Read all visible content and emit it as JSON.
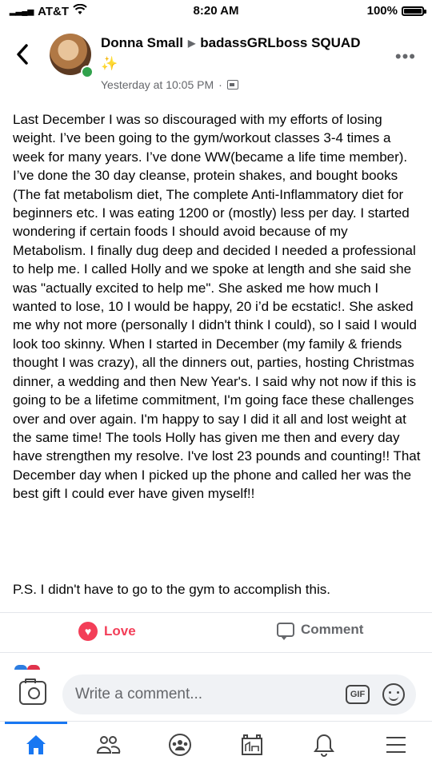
{
  "status_bar": {
    "carrier": "AT&T",
    "time": "8:20 AM",
    "battery": "100%",
    "battery_level": 1.0
  },
  "post": {
    "author": "Donna Small",
    "group": "badassGRLboss SQUAD",
    "emoji": "✨",
    "timestamp": "Yesterday at 10:05 PM",
    "separator": "·",
    "body": "Last December I was so discouraged with my efforts of losing weight. I’ve been going to the gym/workout classes 3-4 times a week for many years.  I’ve done WW(became a life time member). I’ve done the 30 day cleanse, protein shakes, and bought books (The fat metabolism diet, The complete Anti-Inflammatory diet for beginners etc. I was eating 1200 or (mostly) less per day. I started wondering if certain foods I should avoid because of my Metabolism.  I finally dug  deep and decided I needed a professional to help me.  I called Holly and we spoke at length and she said she was \"actually excited to help me\".  She asked me how much I wanted to lose, 10 I would be happy, 20 i’d be ecstatic!.  She asked me why not more (personally I didn't think I could), so I said I would look too skinny.  When I started in December (my family & friends thought I was crazy), all the dinners out, parties, hosting Christmas dinner, a wedding and then New Year's.  I said why not now if this is going to be a lifetime commitment, I'm going face these challenges over and over again.  I'm happy to say I did it all and lost weight at the same time!  The tools Holly has given me then and every day have strengthen my resolve.  I've lost 23 pounds and counting!! That December day when I picked up the phone and called her was the best gift I could ever have given myself!!",
    "ps": "P.S.  I didn't have to go to the gym to accomplish this."
  },
  "actions": {
    "love_label": "Love",
    "comment_label": "Comment"
  },
  "composer": {
    "placeholder": "Write a comment...",
    "gif_label": "GIF"
  },
  "tabs": [
    {
      "name": "home-tab",
      "icon": "home-icon",
      "active": true
    },
    {
      "name": "friends-tab",
      "icon": "friends-icon"
    },
    {
      "name": "groups-tab",
      "icon": "groups-icon"
    },
    {
      "name": "pages-tab",
      "icon": "pages-icon"
    },
    {
      "name": "notifications-tab",
      "icon": "bell-icon"
    },
    {
      "name": "menu-tab",
      "icon": "menu-icon"
    }
  ],
  "colors": {
    "love": "#f33e58",
    "active_tab": "#1877f2",
    "online": "#31a24c",
    "muted": "#65676b"
  }
}
